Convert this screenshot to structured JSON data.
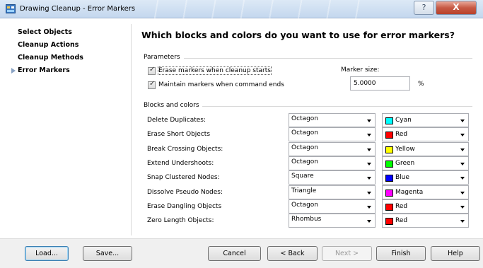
{
  "window": {
    "title": "Drawing Cleanup - Error Markers",
    "help_icon": "?",
    "close_icon": "X"
  },
  "nav": {
    "items": [
      {
        "label": "Select Objects",
        "active": false
      },
      {
        "label": "Cleanup Actions",
        "active": false
      },
      {
        "label": "Cleanup Methods",
        "active": false
      },
      {
        "label": "Error Markers",
        "active": true
      }
    ]
  },
  "heading": "Which blocks and colors do you want to use for error markers?",
  "parameters": {
    "label": "Parameters",
    "erase_markers": {
      "label": "Erase markers when cleanup starts",
      "checked": true
    },
    "maintain_markers": {
      "label": "Maintain markers when command ends",
      "checked": true
    },
    "marker_size_label": "Marker size:",
    "marker_size_value": "5.0000",
    "marker_size_unit": "%"
  },
  "blocks": {
    "label": "Blocks and colors",
    "rows": [
      {
        "label": "Delete Duplicates:",
        "shape": "Octagon",
        "color": "Cyan",
        "color_hex": "#00ffff"
      },
      {
        "label": "Erase Short Objects",
        "shape": "Octagon",
        "color": "Red",
        "color_hex": "#ff0000"
      },
      {
        "label": "Break Crossing Objects:",
        "shape": "Octagon",
        "color": "Yellow",
        "color_hex": "#ffff00"
      },
      {
        "label": "Extend Undershoots:",
        "shape": "Octagon",
        "color": "Green",
        "color_hex": "#00ff00"
      },
      {
        "label": "Snap Clustered Nodes:",
        "shape": "Square",
        "color": "Blue",
        "color_hex": "#0000ff"
      },
      {
        "label": "Dissolve Pseudo Nodes:",
        "shape": "Triangle",
        "color": "Magenta",
        "color_hex": "#ff00ff"
      },
      {
        "label": "Erase Dangling Objects",
        "shape": "Octagon",
        "color": "Red",
        "color_hex": "#ff0000"
      },
      {
        "label": "Zero Length Objects:",
        "shape": "Rhombus",
        "color": "Red",
        "color_hex": "#ff0000"
      }
    ]
  },
  "buttons": {
    "load": "Load...",
    "save": "Save...",
    "cancel": "Cancel",
    "back": "< Back",
    "next": "Next >",
    "finish": "Finish",
    "help": "Help"
  }
}
